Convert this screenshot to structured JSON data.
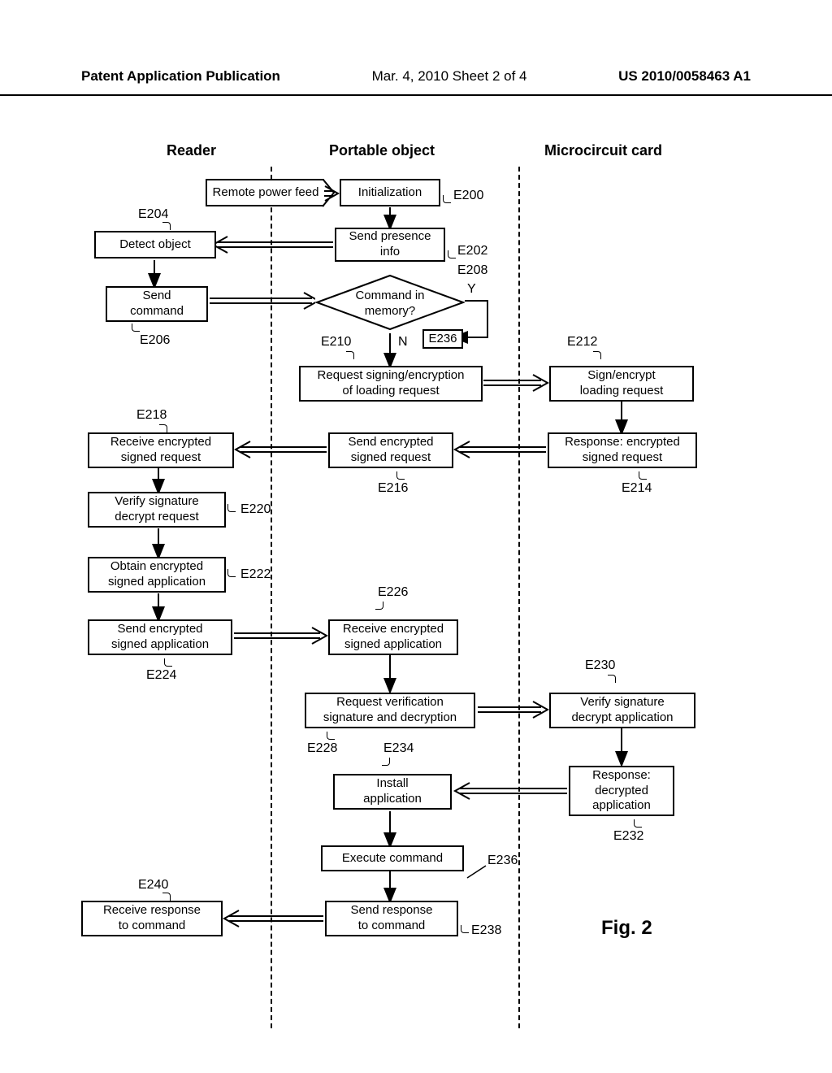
{
  "header": {
    "left": "Patent Application Publication",
    "center": "Mar. 4, 2010  Sheet 2 of 4",
    "right": "US 2010/0058463 A1"
  },
  "columns": {
    "reader": "Reader",
    "portable": "Portable object",
    "card": "Microcircuit card"
  },
  "boxes": {
    "remote_power": "Remote power feed",
    "initialization": "Initialization",
    "detect_object": "Detect object",
    "send_presence": "Send presence\ninfo",
    "send_command": "Send\ncommand",
    "command_in_memory": "Command in\nmemory?",
    "request_signing": "Request signing/encryption\nof loading request",
    "sign_encrypt": "Sign/encrypt\nloading request",
    "receive_encrypted_req": "Receive encrypted\nsigned request",
    "send_encrypted_req": "Send encrypted\nsigned request",
    "response_encrypted_req": "Response: encrypted\nsigned request",
    "verify_sig_req": "Verify signature\ndecrypt request",
    "obtain_app": "Obtain encrypted\nsigned application",
    "send_encrypted_app": "Send encrypted\nsigned application",
    "receive_encrypted_app": "Receive encrypted\nsigned application",
    "request_verification": "Request verification\nsignature and decryption",
    "verify_sig_app": "Verify signature\ndecrypt application",
    "install_app": "Install\napplication",
    "response_decrypted": "Response:\ndecrypted\napplication",
    "execute_command": "Execute command",
    "send_response": "Send response\nto command",
    "receive_response": "Receive response\nto command",
    "e236_box": "E236"
  },
  "refs": {
    "e200": "E200",
    "e202": "E202",
    "e204": "E204",
    "e206": "E206",
    "e208": "E208",
    "e210": "E210",
    "e212": "E212",
    "e214": "E214",
    "e216": "E216",
    "e218": "E218",
    "e220": "E220",
    "e222": "E222",
    "e224": "E224",
    "e226": "E226",
    "e228": "E228",
    "e230": "E230",
    "e232": "E232",
    "e234": "E234",
    "e236": "E236",
    "e238": "E238",
    "e240": "E240"
  },
  "decision": {
    "yes": "Y",
    "no": "N"
  },
  "figure_label": "Fig. 2"
}
